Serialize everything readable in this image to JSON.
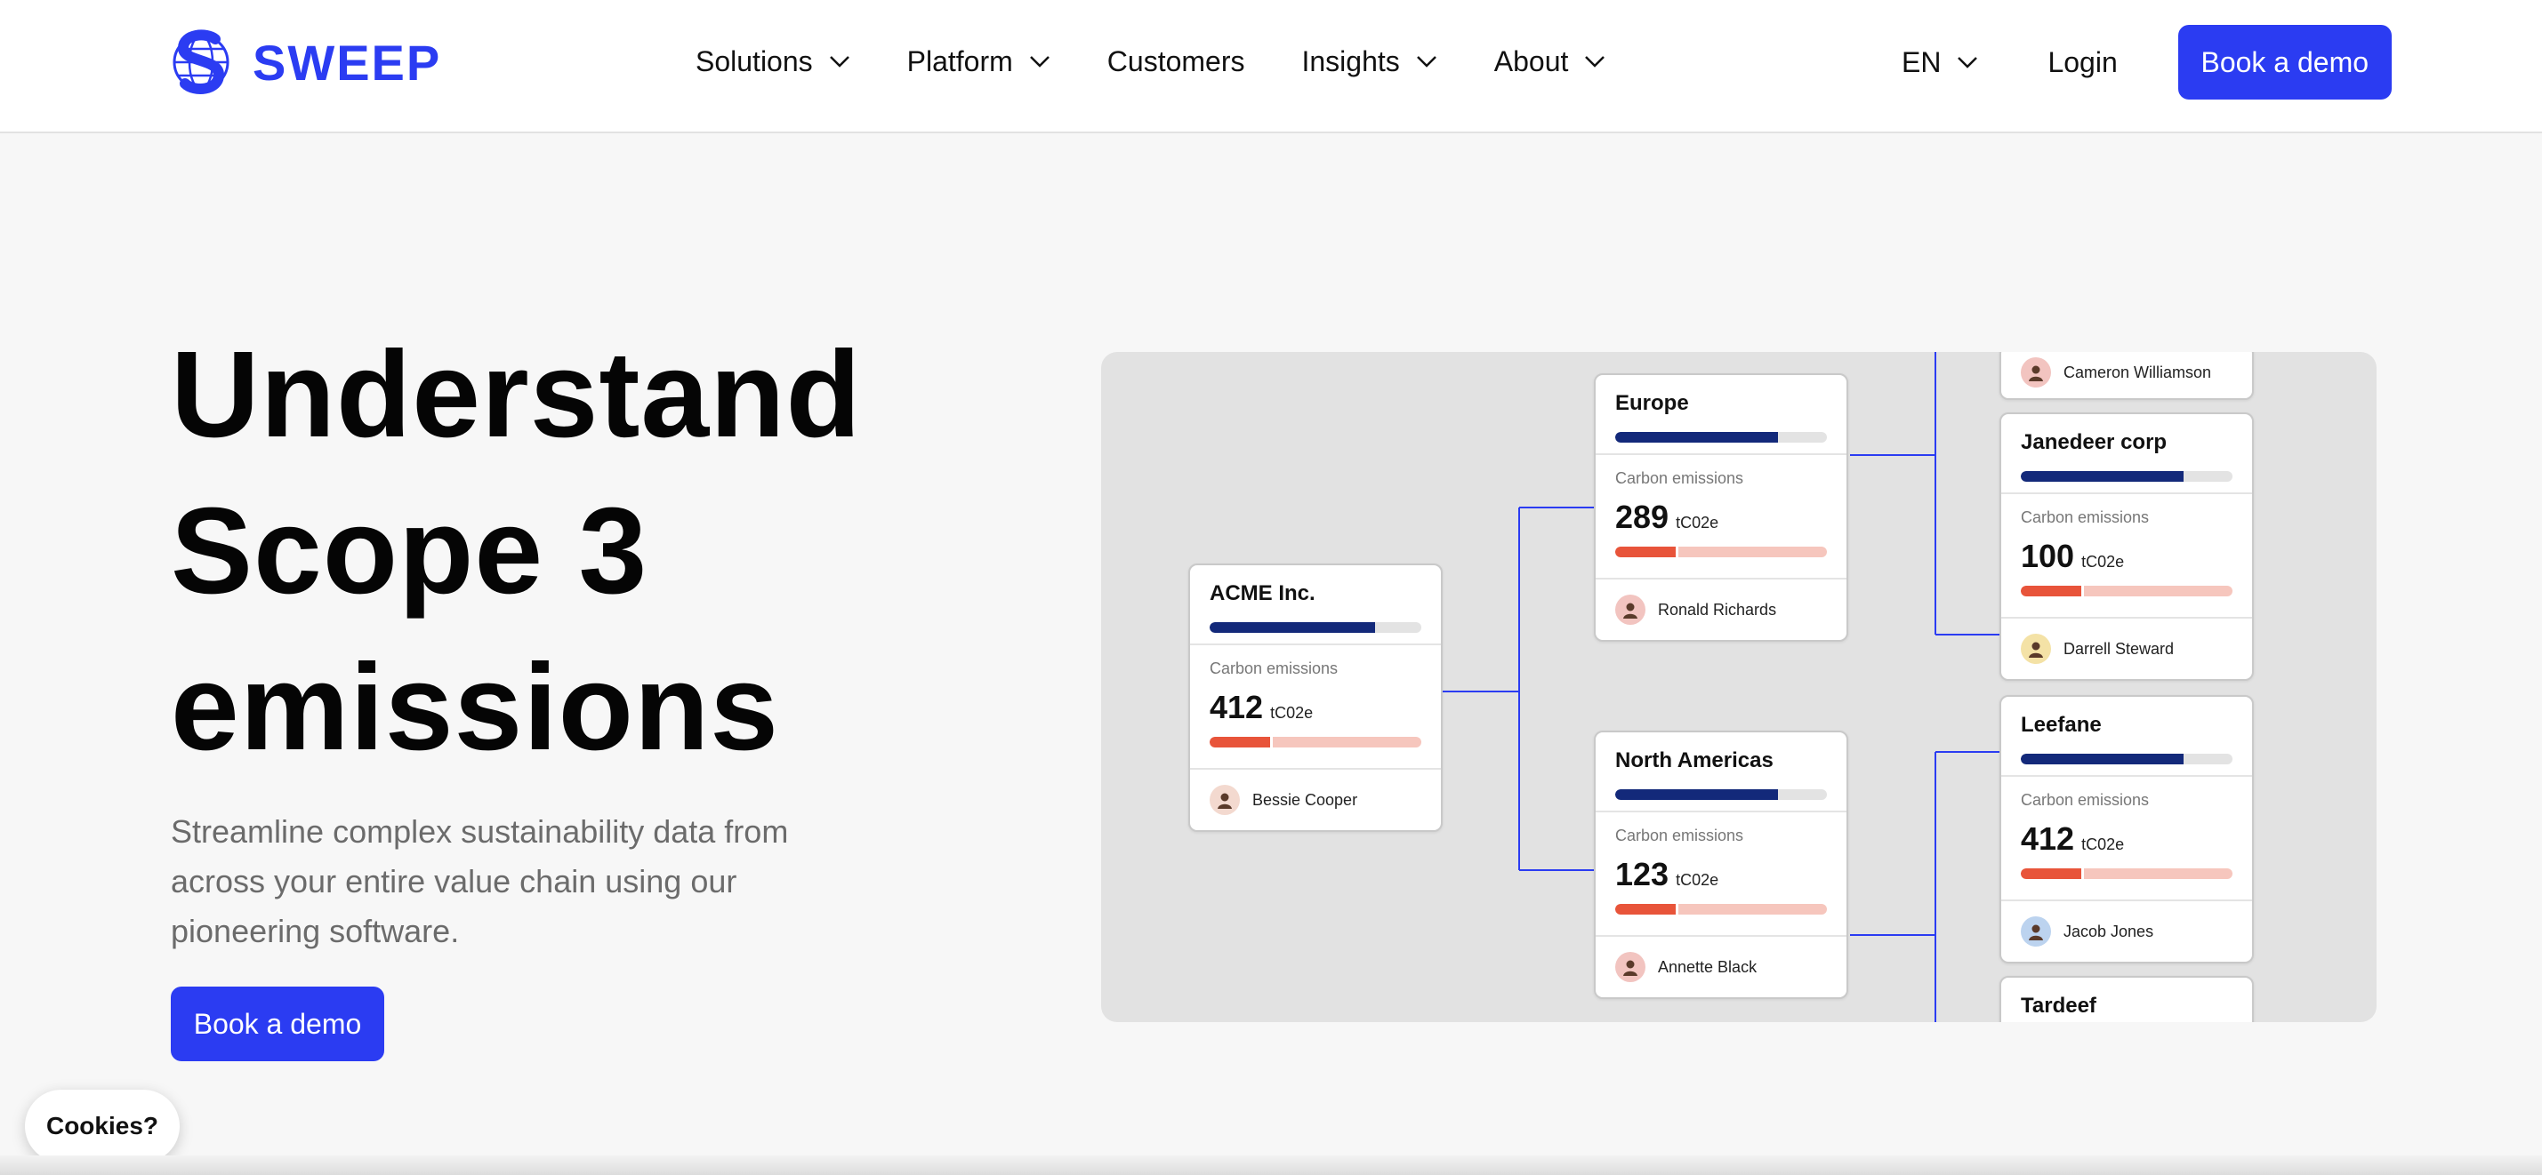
{
  "brand": {
    "name": "SWEEP",
    "color": "#2b3cf2"
  },
  "nav": {
    "items": [
      {
        "label": "Solutions",
        "has_dropdown": true
      },
      {
        "label": "Platform",
        "has_dropdown": true
      },
      {
        "label": "Customers",
        "has_dropdown": false
      },
      {
        "label": "Insights",
        "has_dropdown": true
      },
      {
        "label": "About",
        "has_dropdown": true
      }
    ],
    "language": "EN",
    "login": "Login",
    "cta": "Book a demo"
  },
  "hero": {
    "title_lines": [
      "Understand",
      "Scope 3",
      "emissions"
    ],
    "subtitle": "Streamline complex sustainability data from across your entire value chain using our pioneering software.",
    "cta": "Book a demo"
  },
  "cookies": {
    "label": "Cookies?"
  },
  "diagram": {
    "cards": [
      {
        "id": "acme",
        "name": "ACME Inc.",
        "label": "Carbon emissions",
        "value": "412",
        "unit": "tC02e",
        "person": "Bessie Cooper",
        "progress": 0.78,
        "emission_share": 0.3,
        "avatar_color": "#f3d9cf"
      },
      {
        "id": "europe",
        "name": "Europe",
        "label": "Carbon emissions",
        "value": "289",
        "unit": "tC02e",
        "person": "Ronald Richards",
        "progress": 0.77,
        "emission_share": 0.3,
        "avatar_color": "#f2c4c0"
      },
      {
        "id": "north-americas",
        "name": "North Americas",
        "label": "Carbon emissions",
        "value": "123",
        "unit": "tC02e",
        "person": "Annette Black",
        "progress": 0.77,
        "emission_share": 0.3,
        "avatar_color": "#f2c4c0"
      },
      {
        "id": "cameron",
        "name": "",
        "label": "",
        "value": "",
        "unit": "",
        "person": "Cameron Williamson",
        "progress": 0,
        "emission_share": 0,
        "avatar_color": "#f2c4c0"
      },
      {
        "id": "janedeer",
        "name": "Janedeer corp",
        "label": "Carbon emissions",
        "value": "100",
        "unit": "tC02e",
        "person": "Darrell Steward",
        "progress": 0.77,
        "emission_share": 0.3,
        "avatar_color": "#f4e2a6"
      },
      {
        "id": "leefane",
        "name": "Leefane",
        "label": "Carbon emissions",
        "value": "412",
        "unit": "tC02e",
        "person": "Jacob Jones",
        "progress": 0.77,
        "emission_share": 0.3,
        "avatar_color": "#bcd3ef"
      },
      {
        "id": "tardeef",
        "name": "Tardeef",
        "label": "",
        "value": "",
        "unit": "",
        "person": "",
        "progress": 0,
        "emission_share": 0,
        "avatar_color": "#f2c4c0"
      }
    ]
  }
}
